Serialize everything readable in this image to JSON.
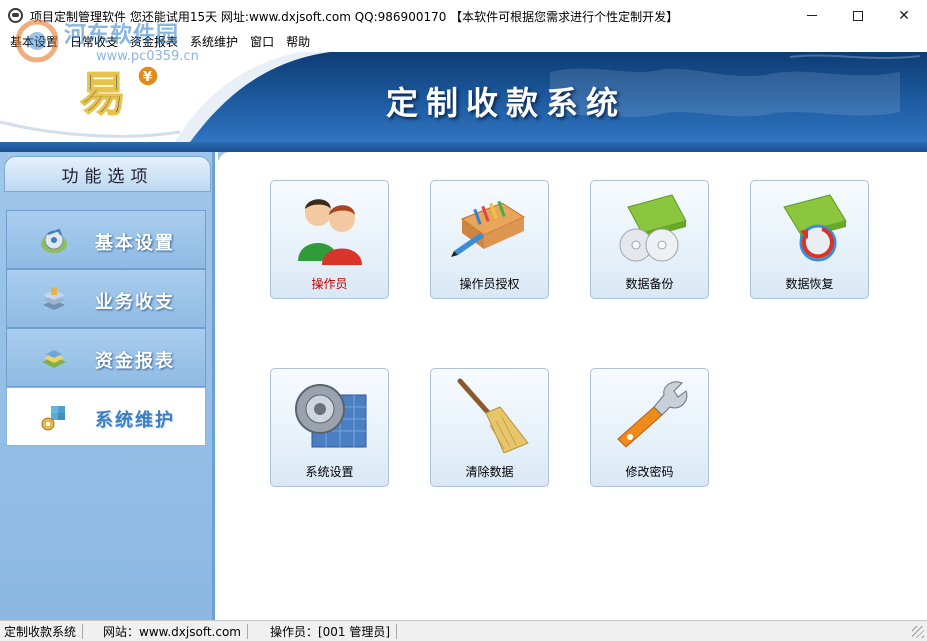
{
  "window": {
    "title": "项目定制管理软件  您还能试用15天   网址:www.dxjsoft.com   QQ:986900170   【本软件可根据您需求进行个性定制开发】",
    "minimize_icon": "minimize-icon",
    "maximize_icon": "maximize-icon",
    "close_icon": "close-icon",
    "close_glyph": "✕"
  },
  "menu": {
    "items": [
      {
        "label": "基本设置"
      },
      {
        "label": "日常收支"
      },
      {
        "label": "资金报表"
      },
      {
        "label": "系统维护"
      },
      {
        "label": "窗口"
      },
      {
        "label": "帮助"
      }
    ]
  },
  "watermark": {
    "text": "河东软件园",
    "url": "www.pc0359.cn"
  },
  "banner": {
    "title": "定制收款系统",
    "logo_icon": "yi-logo-icon",
    "logo_char": "易",
    "logo_badge": "¥"
  },
  "sidebar": {
    "header": "功能选项",
    "items": [
      {
        "label": "基本设置",
        "icon": "disc-settings-icon",
        "active": false
      },
      {
        "label": "业务收支",
        "icon": "stack-icon",
        "active": false
      },
      {
        "label": "资金报表",
        "icon": "report-icon",
        "active": false
      },
      {
        "label": "系统维护",
        "icon": "maintenance-icon",
        "active": true
      }
    ]
  },
  "tiles": [
    {
      "label": "操作员",
      "icon": "operators-icon",
      "highlight": true
    },
    {
      "label": "操作员授权",
      "icon": "pencil-box-icon",
      "highlight": false
    },
    {
      "label": "数据备份",
      "icon": "backup-disc-icon",
      "highlight": false
    },
    {
      "label": "数据恢复",
      "icon": "restore-disc-icon",
      "highlight": false
    },
    {
      "label": "系统设置",
      "icon": "gear-settings-icon",
      "highlight": false
    },
    {
      "label": "清除数据",
      "icon": "broom-icon",
      "highlight": false
    },
    {
      "label": "修改密码",
      "icon": "wrench-icon",
      "highlight": false
    }
  ],
  "status": {
    "system": "定制收款系统",
    "website": "网站：www.dxjsoft.com",
    "operator": "操作员：[001 管理员]"
  },
  "colors": {
    "banner_dark": "#0e3c74",
    "banner_light": "#2f75c0",
    "sidebar_bg": "#9fc6ea",
    "active_label": "#3d7fc1",
    "highlight_label": "#c00000"
  }
}
